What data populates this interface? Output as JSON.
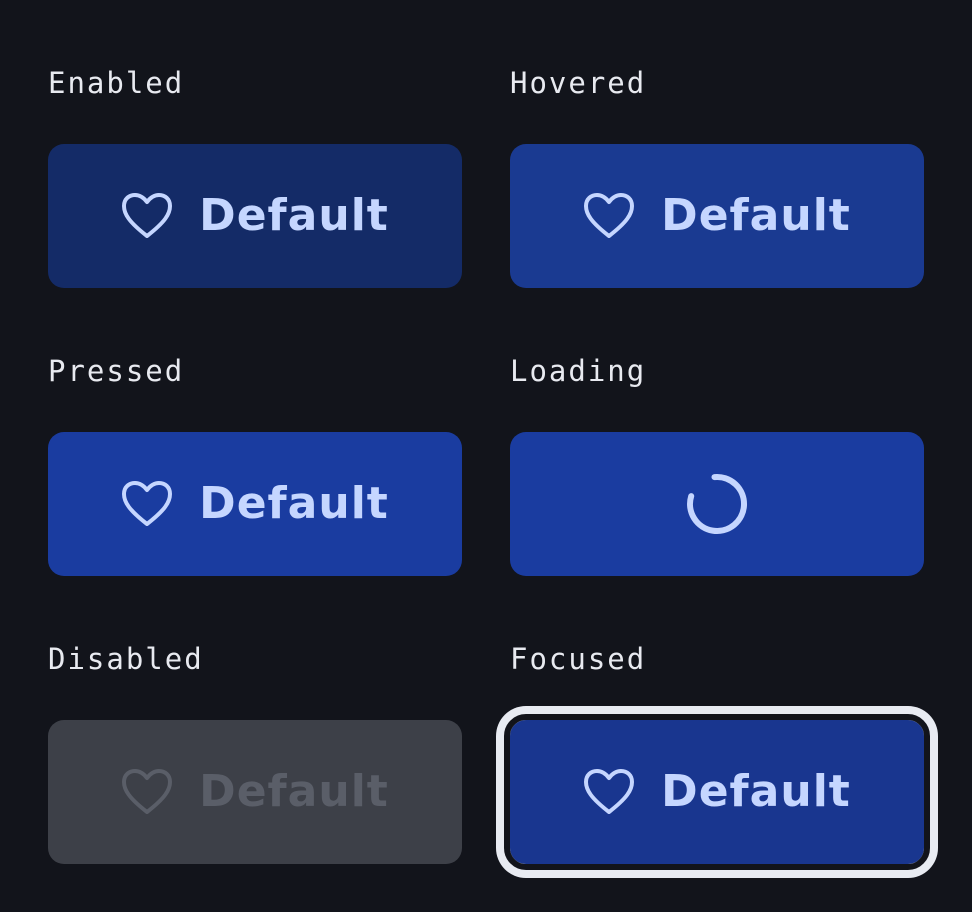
{
  "states": {
    "enabled": {
      "label": "Enabled",
      "button_text": "Default"
    },
    "hovered": {
      "label": "Hovered",
      "button_text": "Default"
    },
    "pressed": {
      "label": "Pressed",
      "button_text": "Default"
    },
    "loading": {
      "label": "Loading"
    },
    "disabled": {
      "label": "Disabled",
      "button_text": "Default"
    },
    "focused": {
      "label": "Focused",
      "button_text": "Default"
    }
  },
  "icons": {
    "button_icon": "heart-icon",
    "loading_icon": "spinner-icon"
  },
  "colors": {
    "background": "#12141b",
    "enabled_bg": "#142b67",
    "hovered_bg": "#1a3a91",
    "pressed_bg": "#1a3ca0",
    "disabled_bg": "#3d4048",
    "focus_ring": "#e8ebf2",
    "content": "#c5d6ff"
  }
}
